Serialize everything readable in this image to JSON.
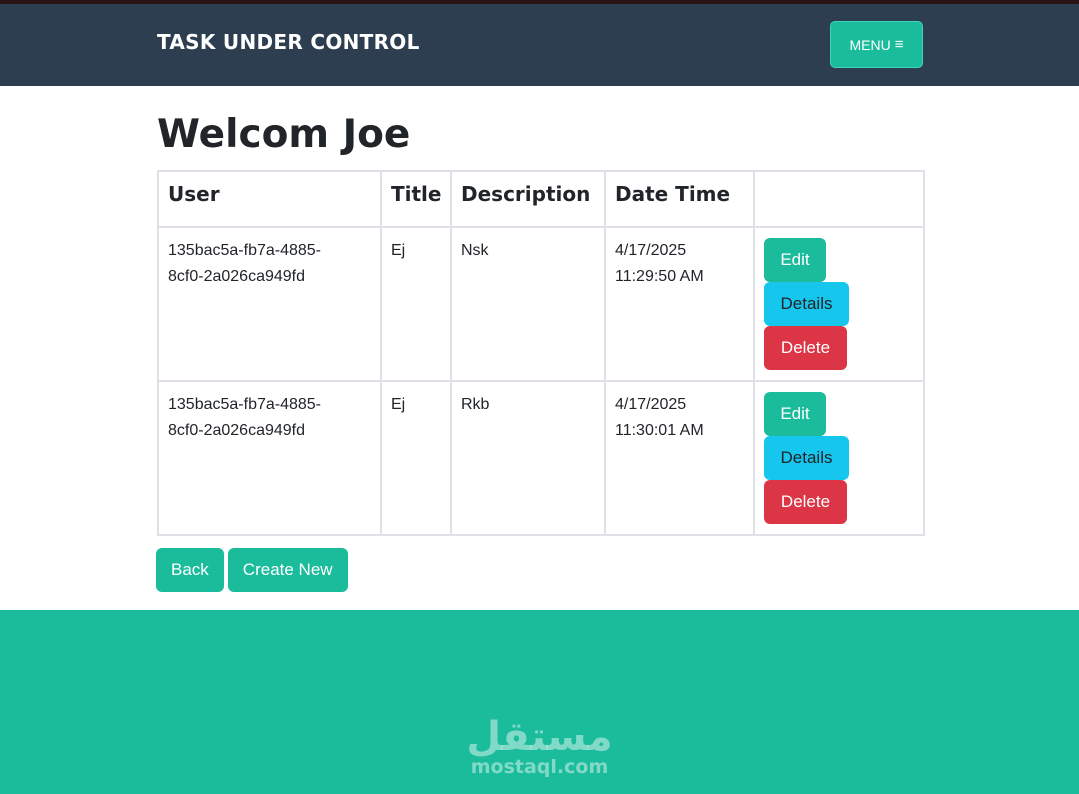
{
  "navbar": {
    "brand": "TASK UNDER CONTROL",
    "menu_label": "MENU",
    "menu_icon": "bars-icon"
  },
  "page": {
    "title": "Welcom Joe"
  },
  "table": {
    "headers": [
      "User",
      "Title",
      "Description",
      "Date Time",
      ""
    ],
    "rows": [
      {
        "user": "135bac5a-fb7a-4885-8cf0-2a026ca949fd",
        "user_line1": "135bac5a-fb7a-4885-",
        "user_line2": "8cf0-2a026ca949fd",
        "title": "Ej",
        "description": "Nsk",
        "date_line1": "4/17/2025",
        "date_line2": "11:29:50 AM"
      },
      {
        "user": "135bac5a-fb7a-4885-8cf0-2a026ca949fd",
        "user_line1": "135bac5a-fb7a-4885-",
        "user_line2": "8cf0-2a026ca949fd",
        "title": "Ej",
        "description": "Rkb",
        "date_line1": "4/17/2025",
        "date_line2": "11:30:01 AM"
      }
    ],
    "actions": {
      "edit": "Edit",
      "details": "Details",
      "delete": "Delete"
    }
  },
  "bottom": {
    "back": "Back",
    "create_new": "Create New"
  },
  "footer": {
    "watermark_ar": "مستقل",
    "watermark_en": "mostaql.com"
  },
  "colors": {
    "navbar": "#2c3e50",
    "accent": "#1abc9c",
    "info": "#17c6ec",
    "danger": "#dc3545"
  }
}
